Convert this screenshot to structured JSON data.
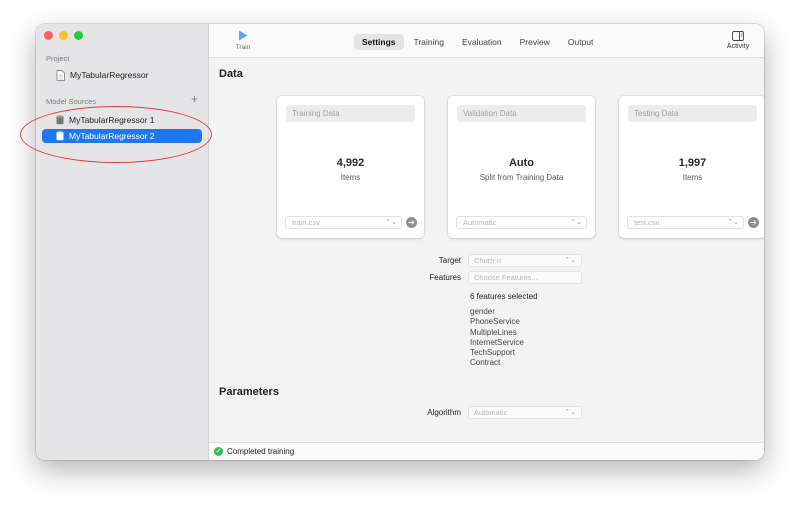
{
  "sidebar": {
    "project_header": "Project",
    "project_name": "MyTabularRegressor",
    "sources_header": "Model Sources",
    "add_icon": "plus",
    "sources": [
      {
        "label": "MyTabularRegressor 1",
        "selected": false
      },
      {
        "label": "MyTabularRegressor 2",
        "selected": true
      }
    ]
  },
  "toolbar": {
    "train_label": "Train",
    "tabs": [
      {
        "label": "Settings",
        "active": true
      },
      {
        "label": "Training",
        "active": false
      },
      {
        "label": "Evaluation",
        "active": false
      },
      {
        "label": "Preview",
        "active": false
      },
      {
        "label": "Output",
        "active": false
      }
    ],
    "activity_label": "Activity"
  },
  "data_section": {
    "title": "Data",
    "cards": [
      {
        "header": "Training Data",
        "value": "4,992",
        "sub": "Items",
        "select_value": "train.csv",
        "has_go": true
      },
      {
        "header": "Validation Data",
        "value": "Auto",
        "sub": "Split from Training Data",
        "select_value": "Automatic",
        "has_go": false
      },
      {
        "header": "Testing Data",
        "value": "1,997",
        "sub": "Items",
        "select_value": "test.csv",
        "has_go": true
      }
    ],
    "target_label": "Target",
    "target_value": "Churn-n",
    "features_label": "Features",
    "features_placeholder": "Choose Features...",
    "features_selected": "6 features selected",
    "features": [
      "gender",
      "PhoneService",
      "MultipleLines",
      "InternetService",
      "TechSupport",
      "Contract"
    ]
  },
  "parameters_section": {
    "title": "Parameters",
    "algorithm_label": "Algorithm",
    "algorithm_value": "Automatic"
  },
  "status": {
    "text": "Completed training",
    "color": "#30c25a"
  },
  "colors": {
    "accent": "#1f78f0",
    "annotation": "#e0403a"
  }
}
